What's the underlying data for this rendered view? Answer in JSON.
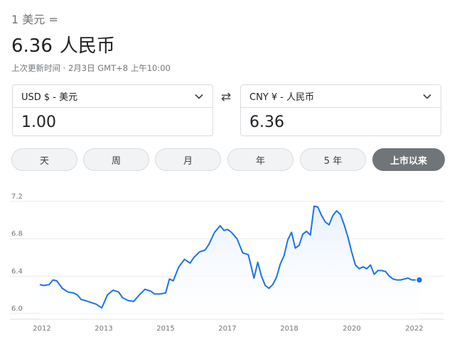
{
  "header": {
    "from_line": "1 美元 =",
    "to_amount": "6.36",
    "to_currency": "人民币",
    "updated": "上次更新时间 · 2月3日 GMT+8 上午10:00"
  },
  "converter": {
    "from_currency": "USD $ - 美元",
    "from_value": "1.00",
    "swap_icon": "swap-icon",
    "to_currency": "CNY ¥ - 人民币",
    "to_value": "6.36"
  },
  "tabs": [
    "天",
    "周",
    "月",
    "年",
    "5 年",
    "上市以来"
  ],
  "active_tab": "上市以来",
  "colors": {
    "line": "#1a73e8",
    "area": "#e8f0fe",
    "active_tab": "#70757a"
  },
  "chart_data": {
    "type": "area",
    "title": "",
    "xlabel": "",
    "ylabel": "",
    "ylim": [
      6.0,
      7.2
    ],
    "xlim": [
      2012,
      2022.1
    ],
    "y_ticks": [
      "7.2",
      "6.8",
      "6.4",
      "6.0"
    ],
    "x_ticks": [
      "2012",
      "2013",
      "2015",
      "2017",
      "2018",
      "2020",
      "2022"
    ],
    "grid": true,
    "series": [
      {
        "x": [
          2012.0,
          2012.1,
          2012.25,
          2012.35,
          2012.45,
          2012.6,
          2012.75,
          2012.9,
          2013.0,
          2013.1,
          2013.2,
          2013.35,
          2013.5,
          2013.65,
          2013.8,
          2013.95,
          2014.1,
          2014.2,
          2014.35,
          2014.5,
          2014.65,
          2014.8,
          2014.95,
          2015.05,
          2015.2,
          2015.35,
          2015.45,
          2015.55,
          2015.7,
          2015.85,
          2016.0,
          2016.1,
          2016.25,
          2016.4,
          2016.5,
          2016.65,
          2016.8,
          2016.9,
          2017.0,
          2017.1,
          2017.25,
          2017.4,
          2017.55,
          2017.7,
          2017.8,
          2017.9,
          2018.0,
          2018.1,
          2018.2,
          2018.3,
          2018.4,
          2018.5,
          2018.6,
          2018.7,
          2018.8,
          2018.9,
          2019.0,
          2019.1,
          2019.2,
          2019.3,
          2019.4,
          2019.5,
          2019.6,
          2019.7,
          2019.8,
          2019.9,
          2020.0,
          2020.1,
          2020.2,
          2020.3,
          2020.4,
          2020.5,
          2020.6,
          2020.7,
          2020.8,
          2020.9,
          2021.0,
          2021.1,
          2021.2,
          2021.3,
          2021.4,
          2021.5,
          2021.6,
          2021.7,
          2021.8,
          2021.9,
          2022.0,
          2022.1
        ],
        "values": [
          6.31,
          6.3,
          6.31,
          6.36,
          6.35,
          6.27,
          6.23,
          6.22,
          6.2,
          6.15,
          6.14,
          6.12,
          6.1,
          6.06,
          6.2,
          6.25,
          6.23,
          6.17,
          6.14,
          6.13,
          6.2,
          6.26,
          6.24,
          6.21,
          6.21,
          6.22,
          6.37,
          6.35,
          6.5,
          6.58,
          6.54,
          6.6,
          6.66,
          6.68,
          6.74,
          6.87,
          6.94,
          6.89,
          6.9,
          6.87,
          6.8,
          6.65,
          6.63,
          6.38,
          6.55,
          6.4,
          6.3,
          6.27,
          6.31,
          6.39,
          6.53,
          6.62,
          6.79,
          6.87,
          6.7,
          6.73,
          6.85,
          6.88,
          6.84,
          7.15,
          7.14,
          7.05,
          6.98,
          6.95,
          7.05,
          7.1,
          7.06,
          6.95,
          6.82,
          6.66,
          6.52,
          6.48,
          6.5,
          6.48,
          6.52,
          6.42,
          6.46,
          6.46,
          6.45,
          6.4,
          6.37,
          6.36,
          6.36,
          6.37,
          6.38,
          6.36,
          6.36,
          6.36
        ]
      }
    ]
  }
}
